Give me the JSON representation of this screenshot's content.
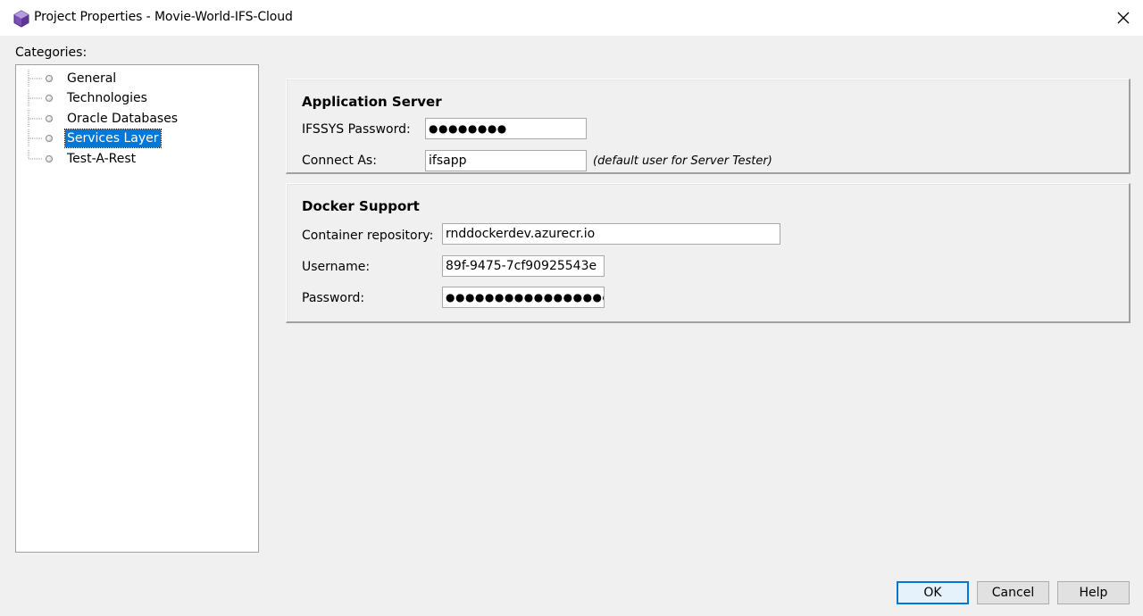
{
  "window": {
    "title": "Project Properties - Movie-World-IFS-Cloud",
    "close_label": "✕",
    "icon": "cube-icon"
  },
  "categories": {
    "label": "Categories:",
    "items": [
      {
        "label": "General",
        "selected": false
      },
      {
        "label": "Technologies",
        "selected": false
      },
      {
        "label": "Oracle Databases",
        "selected": false
      },
      {
        "label": "Services Layer",
        "selected": true
      },
      {
        "label": "Test-A-Rest",
        "selected": false
      }
    ]
  },
  "app_server": {
    "title": "Application Server",
    "password_label": "IFSSYS Password:",
    "password_value": "●●●●●●●●",
    "connect_label": "Connect As:",
    "connect_value": "ifsapp",
    "connect_hint": "(default user for Server Tester)"
  },
  "docker": {
    "title": "Docker Support",
    "repo_label": "Container repository:",
    "repo_value": "rnddockerdev.azurecr.io",
    "username_label": "Username:",
    "username_value": "89f-9475-7cf90925543e",
    "password_label": "Password:",
    "password_value": "●●●●●●●●●●●●●●●●●●●●"
  },
  "buttons": {
    "ok": "OK",
    "cancel": "Cancel",
    "help": "Help"
  }
}
